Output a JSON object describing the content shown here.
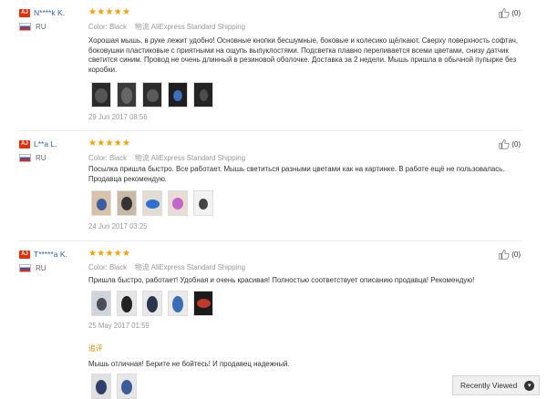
{
  "reviews": [
    {
      "badge": "AJ",
      "name": "N****k K.",
      "country": "RU",
      "stars": "★★★★★",
      "likes": "(0)",
      "color_label": "Color: Black",
      "shipping": "物流 AliExpress Standard Shipping",
      "text": "Хорошая мышь, в руке лежит удобно! Основные кнопки бесшумные, боковые и колесико щёлкают. Сверху поверхность софтач, боковушки пластиковые с приятными на ощупь выпуклостями. Подсветка плавно переливается всеми цветами, снизу датчик светится синим. Провод не очень длинный в резиновой оболочке. Доставка за 2 недели. Мышь пришла в обычной пупырке без коробки.",
      "photo_count": 5,
      "date": "29 Jun 2017 08:56"
    },
    {
      "badge": "AJ",
      "name": "L**a L.",
      "country": "RU",
      "stars": "★★★★★",
      "likes": "(0)",
      "color_label": "Color: Black",
      "shipping": "物流 AliExpress Standard Shipping",
      "text": "Посылка пришла быстро. Все работает. Мышь светиться разными цветами как на картинке. В работе ещё не пользовалась. Продавца рекомендую.",
      "photo_count": 5,
      "date": "24 Jun 2017 03:25"
    },
    {
      "badge": "AJ",
      "name": "T*****a K.",
      "country": "RU",
      "stars": "★★★★★",
      "likes": "(0)",
      "color_label": "Color: Black",
      "shipping": "物流 AliExpress Standard Shipping",
      "text": "Пришла быстро, работает! Удобная и очень красивая! Полностью соответствует описанию продавца! Рекомендую!",
      "photo_count": 5,
      "date": "25 May 2017 01:59",
      "additional_label": "追评",
      "additional_text": "Мышь отличная! Берите не бойтесь! И продавец надежный.",
      "additional_photo_count": 2
    }
  ],
  "recently_viewed": {
    "label": "Recently Viewed",
    "icon": "chevron-down-circle-icon"
  },
  "colors": {
    "star": "#f4a006",
    "username": "#2a63b8",
    "badge": "#e62e04",
    "additional_label": "#e08a00"
  }
}
